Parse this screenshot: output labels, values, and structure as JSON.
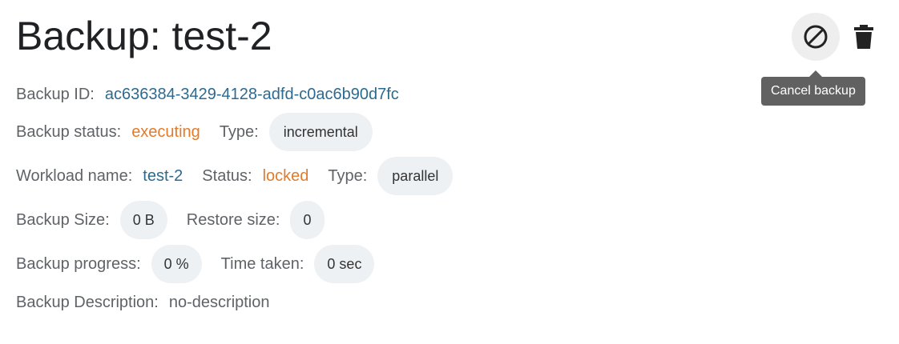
{
  "page": {
    "title": "Backup: test-2"
  },
  "actions": {
    "cancel_tooltip": "Cancel backup"
  },
  "details": {
    "backup_id_label": "Backup ID:",
    "backup_id": "ac636384-3429-4128-adfd-c0ac6b90d7fc",
    "backup_status_label": "Backup status:",
    "backup_status": "executing",
    "backup_type_label": "Type:",
    "backup_type": "incremental",
    "workload_name_label": "Workload name:",
    "workload_name": "test-2",
    "workload_status_label": "Status:",
    "workload_status": "locked",
    "workload_type_label": "Type:",
    "workload_type": "parallel",
    "backup_size_label": "Backup Size:",
    "backup_size": "0 B",
    "restore_size_label": "Restore size:",
    "restore_size": "0",
    "backup_progress_label": "Backup progress:",
    "backup_progress": "0 %",
    "time_taken_label": "Time taken:",
    "time_taken": "0 sec",
    "description_label": "Backup Description:",
    "description": "no-description"
  },
  "colors": {
    "link": "#2c6a8f",
    "warning": "#e37b2b",
    "chip_bg": "#eef1f4",
    "tooltip_bg": "#616161"
  },
  "icons": {
    "cancel": "block-icon",
    "delete": "trash-icon"
  }
}
